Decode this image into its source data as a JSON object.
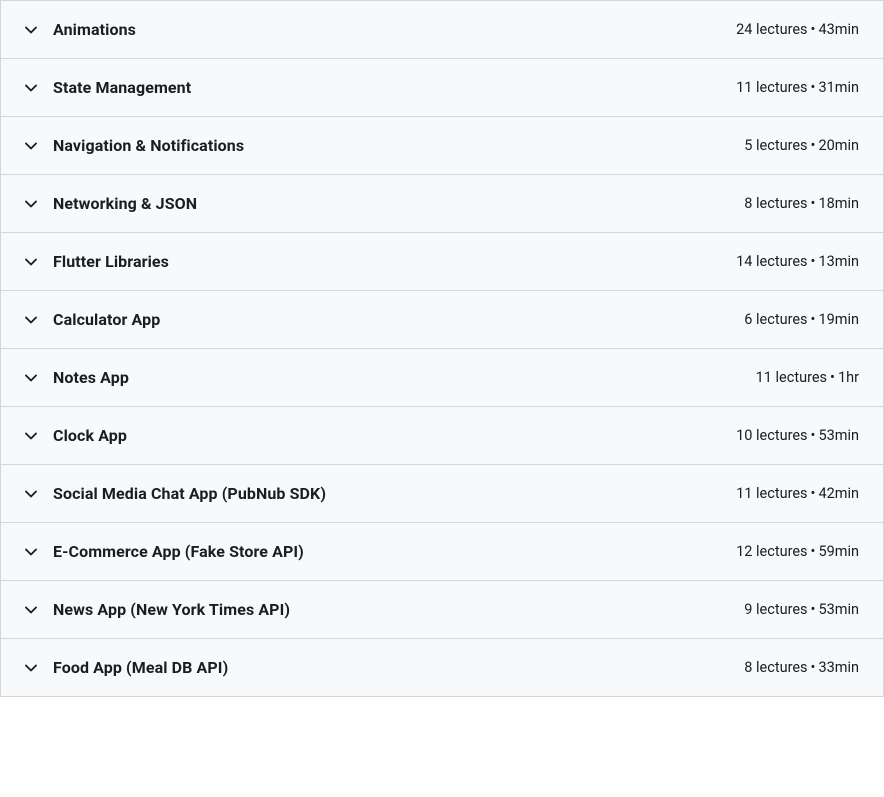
{
  "sections": [
    {
      "title": "Animations",
      "lectures": "24 lectures",
      "duration": "43min"
    },
    {
      "title": "State Management",
      "lectures": "11 lectures",
      "duration": "31min"
    },
    {
      "title": "Navigation & Notifications",
      "lectures": "5 lectures",
      "duration": "20min"
    },
    {
      "title": "Networking & JSON",
      "lectures": "8 lectures",
      "duration": "18min"
    },
    {
      "title": "Flutter Libraries",
      "lectures": "14 lectures",
      "duration": "13min"
    },
    {
      "title": "Calculator App",
      "lectures": "6 lectures",
      "duration": "19min"
    },
    {
      "title": "Notes App",
      "lectures": "11 lectures",
      "duration": "1hr"
    },
    {
      "title": "Clock App",
      "lectures": "10 lectures",
      "duration": "53min"
    },
    {
      "title": "Social Media Chat App (PubNub SDK)",
      "lectures": "11 lectures",
      "duration": "42min"
    },
    {
      "title": "E-Commerce App (Fake Store API)",
      "lectures": "12 lectures",
      "duration": "59min"
    },
    {
      "title": "News App (New York Times API)",
      "lectures": "9 lectures",
      "duration": "53min"
    },
    {
      "title": "Food App (Meal DB API)",
      "lectures": "8 lectures",
      "duration": "33min"
    }
  ],
  "separator": "•"
}
